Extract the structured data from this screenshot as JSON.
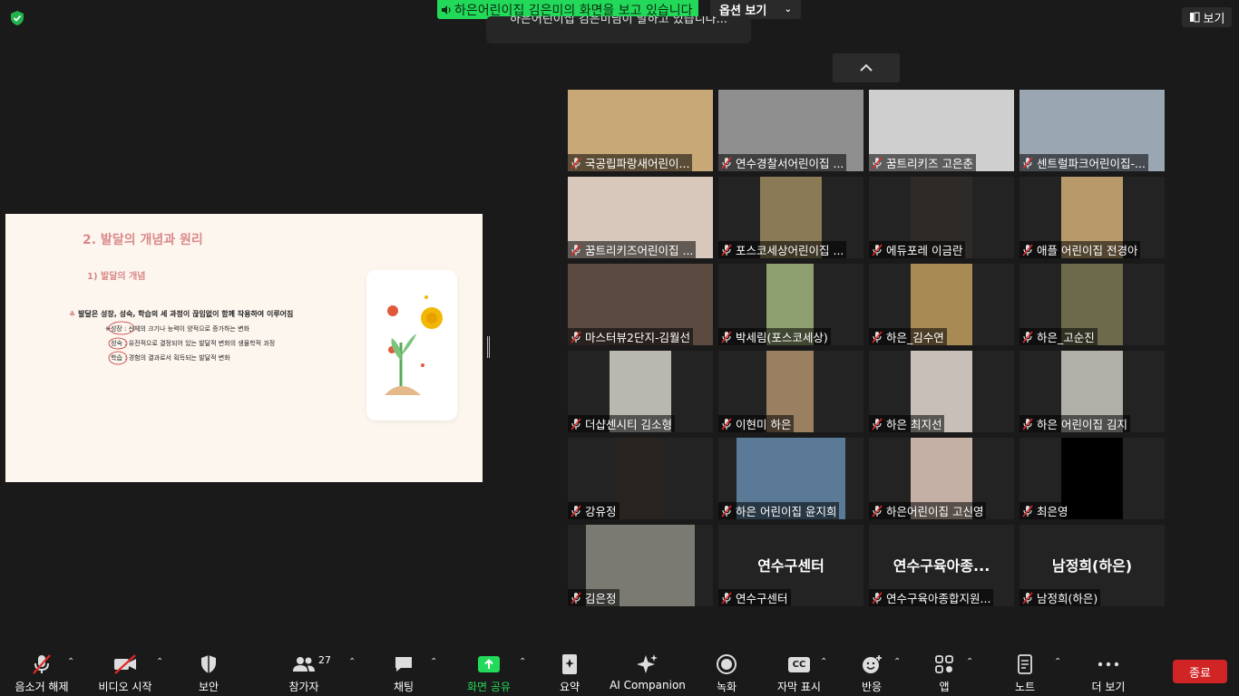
{
  "top": {
    "share_banner": "하은어린이집 김은미의 화면을 보고 있습니다",
    "view_options": "옵션 보기",
    "talking_text": "하은어린이집 김은미님이 말하고 있습니다...",
    "view_label": "보기"
  },
  "slide": {
    "title": "2. 발달의 개념과 원리",
    "subtitle": "1) 발달의 개념",
    "main_point": "발달은 성장, 성숙, 학습의 세 과정이 끊임없이 함께 작용하여 이루어짐",
    "lines": [
      "※성장 : 신체의 크기나 능력이 양적으로 증가하는 변화",
      "성숙 : 유전적으로 결정되어 있는 발달적 변화의 생물학적 과정",
      "학습 : 경험의 결과로서 획득되는 발달적 변화"
    ]
  },
  "participants": [
    {
      "name": "국공립파랑새어린이...",
      "bg": "#c9a878",
      "vl": 0,
      "vw": 160
    },
    {
      "name": "연수경찰서어린이집 ...",
      "bg": "#8f8f8f",
      "vl": 0,
      "vw": 160
    },
    {
      "name": "꿈트리키즈 고은춘",
      "bg": "#cfcfcf",
      "vl": 0,
      "vw": 160
    },
    {
      "name": "센트럴파크어린이집-...",
      "bg": "#9aa6b2",
      "vl": 0,
      "vw": 160
    },
    {
      "name": "꿈트리키즈어린이집 ...",
      "bg": "#d8c8bb",
      "vl": 0,
      "vw": 160
    },
    {
      "name": "포스코세상어린이집 ...",
      "bg": "#8a7a55",
      "vl": 46,
      "vw": 68
    },
    {
      "name": "에듀포레 이금란",
      "bg": "#2e2a28",
      "vl": 46,
      "vw": 68
    },
    {
      "name": "애플 어린이집 전경아",
      "bg": "#b89a6a",
      "vl": 46,
      "vw": 68
    },
    {
      "name": "마스터뷰2단지-김월선",
      "bg": "#5a4a40",
      "vl": 0,
      "vw": 160
    },
    {
      "name": "박세림(포스코세상)",
      "bg": "#8fa070",
      "vl": 53,
      "vw": 52
    },
    {
      "name": "하은_김수연",
      "bg": "#a88a55",
      "vl": 46,
      "vw": 68
    },
    {
      "name": "하은_고순진",
      "bg": "#6d6a4c",
      "vl": 46,
      "vw": 68
    },
    {
      "name": "더샵센시티 김소형",
      "bg": "#b8b8b0",
      "vl": 46,
      "vw": 68
    },
    {
      "name": "이현미 하은",
      "bg": "#9a8060",
      "vl": 53,
      "vw": 52
    },
    {
      "name": "하은 최지선",
      "bg": "#c8c0b8",
      "vl": 46,
      "vw": 68
    },
    {
      "name": "하은 어린이집 김지",
      "bg": "#b0b0a8",
      "vl": 46,
      "vw": 68
    },
    {
      "name": "강유정",
      "bg": "#2a2420",
      "vl": 53,
      "vw": 52
    },
    {
      "name": "하은 어린이집 윤지희",
      "bg": "#5a7a98",
      "vl": 20,
      "vw": 120
    },
    {
      "name": "하은어린이집 고신영",
      "bg": "#c4b0a4",
      "vl": 46,
      "vw": 68
    },
    {
      "name": "최은영",
      "bg": "#000000",
      "vl": 46,
      "vw": 68
    },
    {
      "name": "김은정",
      "bg": "#7a7a72",
      "vl": 20,
      "vw": 120
    },
    {
      "name": "연수구센터",
      "bg": "",
      "vl": 0,
      "vw": 0,
      "center": "연수구센터"
    },
    {
      "name": "연수구육아종합지원...",
      "bg": "",
      "vl": 0,
      "vw": 0,
      "center": "연수구육아종..."
    },
    {
      "name": "남정희(하은)",
      "bg": "",
      "vl": 0,
      "vw": 0,
      "center": "남정희(하은)"
    }
  ],
  "toolbar": {
    "mute": "음소거 해제",
    "video": "비디오 시작",
    "security": "보안",
    "participants": "참가자",
    "participants_count": "27",
    "chat": "채팅",
    "share": "화면 공유",
    "summary": "요약",
    "ai": "AI Companion",
    "record": "녹화",
    "captions": "자막 표시",
    "cc": "CC",
    "reactions": "반응",
    "apps": "앱",
    "notes": "노트",
    "more": "더 보기",
    "end": "종료"
  },
  "colors": {
    "accent_green": "#23d959",
    "end_red": "#d12424",
    "mute_red": "#e02828"
  }
}
